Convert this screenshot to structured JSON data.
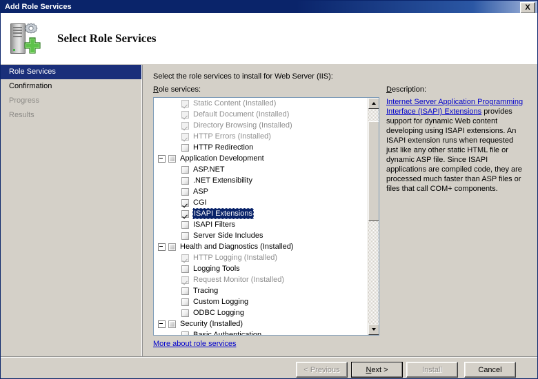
{
  "window": {
    "title": "Add Role Services",
    "close_label": "X"
  },
  "header": {
    "title": "Select Role Services",
    "icon": "server-add-icon"
  },
  "sidebar": {
    "items": [
      {
        "label": "Role Services",
        "state": "active"
      },
      {
        "label": "Confirmation",
        "state": "normal"
      },
      {
        "label": "Progress",
        "state": "disabled"
      },
      {
        "label": "Results",
        "state": "disabled"
      }
    ]
  },
  "main": {
    "instruction": "Select the role services to install for Web Server (IIS):",
    "role_services_label": "Role services:",
    "description_label": "Description:",
    "more_link": "More about role services",
    "tree": [
      {
        "label": "Static Content",
        "suffix": "(Installed)",
        "indent": 1,
        "type": "checkbox",
        "checked": true,
        "disabled": true,
        "selected": false
      },
      {
        "label": "Default Document",
        "suffix": "(Installed)",
        "indent": 1,
        "type": "checkbox",
        "checked": true,
        "disabled": true,
        "selected": false
      },
      {
        "label": "Directory Browsing",
        "suffix": "(Installed)",
        "indent": 1,
        "type": "checkbox",
        "checked": true,
        "disabled": true,
        "selected": false
      },
      {
        "label": "HTTP Errors",
        "suffix": "(Installed)",
        "indent": 1,
        "type": "checkbox",
        "checked": true,
        "disabled": true,
        "selected": false
      },
      {
        "label": "HTTP Redirection",
        "suffix": "",
        "indent": 1,
        "type": "checkbox",
        "checked": false,
        "disabled": false,
        "selected": false
      },
      {
        "label": "Application Development",
        "suffix": "",
        "indent": 0,
        "type": "group",
        "expanded": true,
        "selected": false
      },
      {
        "label": "ASP.NET",
        "suffix": "",
        "indent": 1,
        "type": "checkbox",
        "checked": false,
        "disabled": false,
        "selected": false
      },
      {
        "label": ".NET Extensibility",
        "suffix": "",
        "indent": 1,
        "type": "checkbox",
        "checked": false,
        "disabled": false,
        "selected": false
      },
      {
        "label": "ASP",
        "suffix": "",
        "indent": 1,
        "type": "checkbox",
        "checked": false,
        "disabled": false,
        "selected": false
      },
      {
        "label": "CGI",
        "suffix": "",
        "indent": 1,
        "type": "checkbox",
        "checked": true,
        "disabled": false,
        "selected": false
      },
      {
        "label": "ISAPI Extensions",
        "suffix": "",
        "indent": 1,
        "type": "checkbox",
        "checked": true,
        "disabled": false,
        "selected": true
      },
      {
        "label": "ISAPI Filters",
        "suffix": "",
        "indent": 1,
        "type": "checkbox",
        "checked": false,
        "disabled": false,
        "selected": false
      },
      {
        "label": "Server Side Includes",
        "suffix": "",
        "indent": 1,
        "type": "checkbox",
        "checked": false,
        "disabled": false,
        "selected": false
      },
      {
        "label": "Health and Diagnostics",
        "suffix": "(Installed)",
        "indent": 0,
        "type": "group",
        "expanded": true,
        "selected": false
      },
      {
        "label": "HTTP Logging",
        "suffix": "(Installed)",
        "indent": 1,
        "type": "checkbox",
        "checked": true,
        "disabled": true,
        "selected": false
      },
      {
        "label": "Logging Tools",
        "suffix": "",
        "indent": 1,
        "type": "checkbox",
        "checked": false,
        "disabled": false,
        "selected": false
      },
      {
        "label": "Request Monitor",
        "suffix": "(Installed)",
        "indent": 1,
        "type": "checkbox",
        "checked": true,
        "disabled": true,
        "selected": false
      },
      {
        "label": "Tracing",
        "suffix": "",
        "indent": 1,
        "type": "checkbox",
        "checked": false,
        "disabled": false,
        "selected": false
      },
      {
        "label": "Custom Logging",
        "suffix": "",
        "indent": 1,
        "type": "checkbox",
        "checked": false,
        "disabled": false,
        "selected": false
      },
      {
        "label": "ODBC Logging",
        "suffix": "",
        "indent": 1,
        "type": "checkbox",
        "checked": false,
        "disabled": false,
        "selected": false
      },
      {
        "label": "Security",
        "suffix": "(Installed)",
        "indent": 0,
        "type": "group",
        "expanded": true,
        "selected": false
      },
      {
        "label": "Basic Authentication",
        "suffix": "",
        "indent": 1,
        "type": "checkbox",
        "checked": false,
        "disabled": false,
        "selected": false
      }
    ],
    "description": {
      "link_text": "Internet Server Application Programming Interface (ISAPI) Extensions",
      "body_text": " provides support for dynamic Web content developing using ISAPI extensions. An ISAPI extension runs when requested just like any other static HTML file or dynamic ASP file. Since ISAPI applications are compiled code, they are processed much faster than ASP files or files that call COM+ components."
    }
  },
  "buttons": {
    "previous": "< Previous",
    "next": "Next >",
    "install": "Install",
    "cancel": "Cancel"
  },
  "colors": {
    "titlebar": "#0a246a",
    "face": "#d4d0c8",
    "selection": "#0a246a",
    "link": "#0000cc"
  }
}
